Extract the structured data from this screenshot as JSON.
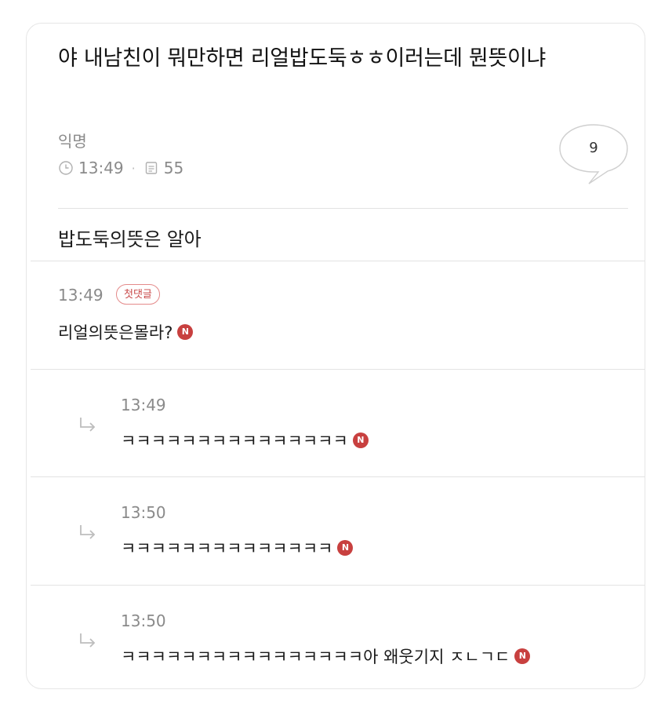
{
  "post": {
    "title": "야 내남친이 뭐만하면 리얼밥도둑ㅎㅎ이러는데 뭔뜻이냐",
    "author": "익명",
    "time": "13:49",
    "views": "55",
    "comment_count": "9",
    "body": "밥도둑의뜻은 알아"
  },
  "comments": [
    {
      "time": "13:49",
      "badge": "첫댓글",
      "text": "리얼의뜻은몰라?",
      "new_badge": "N"
    }
  ],
  "replies": [
    {
      "time": "13:49",
      "text": "ㅋㅋㅋㅋㅋㅋㅋㅋㅋㅋㅋㅋㅋㅋㅋ",
      "new_badge": "N"
    },
    {
      "time": "13:50",
      "text": "ㅋㅋㅋㅋㅋㅋㅋㅋㅋㅋㅋㅋㅋㅋ",
      "new_badge": "N"
    },
    {
      "time": "13:50",
      "text": "ㅋㅋㅋㅋㅋㅋㅋㅋㅋㅋㅋㅋㅋㅋㅋㅋ아 왜웃기지 ㅈㄴㄱㄷ",
      "new_badge": "N"
    }
  ],
  "colors": {
    "new_badge": "#c8403f",
    "first_badge_border": "#e48a8a",
    "meta_text": "#8a8a8a"
  }
}
